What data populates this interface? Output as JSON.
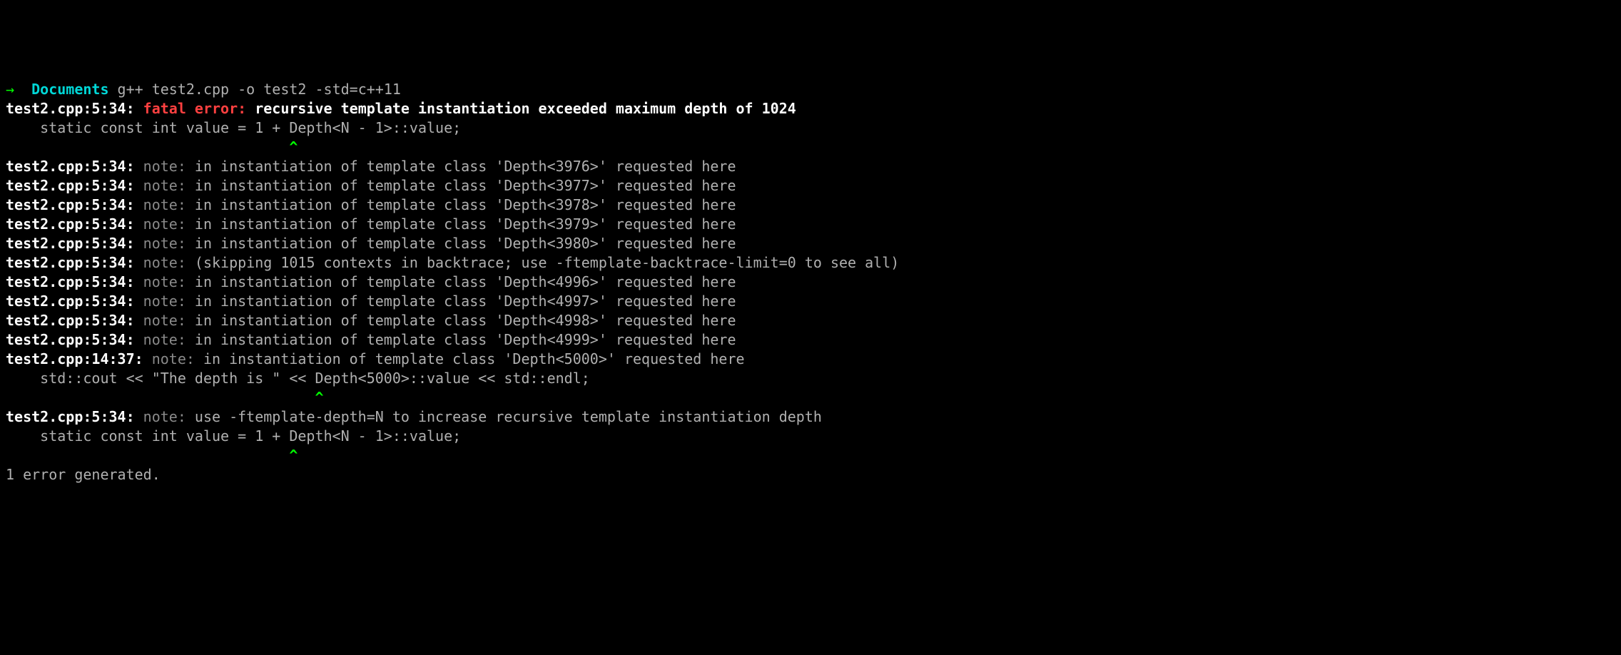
{
  "prompt": {
    "arrow": "→  ",
    "dir": "Documents",
    "cmd": " g++ test2.cpp -o test2 -std=c++11"
  },
  "error": {
    "loc": "test2.cpp:5:34: ",
    "kind": "fatal error: ",
    "msg": "recursive template instantiation exceeded maximum depth of 1024",
    "code": "    static const int value = 1 + Depth<N - 1>::value;",
    "caret": "                                 ^"
  },
  "notes_a": [
    {
      "loc": "test2.cpp:5:34: ",
      "kind": "note: ",
      "msg": "in instantiation of template class 'Depth<3976>' requested here"
    },
    {
      "loc": "test2.cpp:5:34: ",
      "kind": "note: ",
      "msg": "in instantiation of template class 'Depth<3977>' requested here"
    },
    {
      "loc": "test2.cpp:5:34: ",
      "kind": "note: ",
      "msg": "in instantiation of template class 'Depth<3978>' requested here"
    },
    {
      "loc": "test2.cpp:5:34: ",
      "kind": "note: ",
      "msg": "in instantiation of template class 'Depth<3979>' requested here"
    },
    {
      "loc": "test2.cpp:5:34: ",
      "kind": "note: ",
      "msg": "in instantiation of template class 'Depth<3980>' requested here"
    }
  ],
  "skip": {
    "loc": "test2.cpp:5:34: ",
    "kind": "note: ",
    "msg": "(skipping 1015 contexts in backtrace; use -ftemplate-backtrace-limit=0 to see all)"
  },
  "notes_b": [
    {
      "loc": "test2.cpp:5:34: ",
      "kind": "note: ",
      "msg": "in instantiation of template class 'Depth<4996>' requested here"
    },
    {
      "loc": "test2.cpp:5:34: ",
      "kind": "note: ",
      "msg": "in instantiation of template class 'Depth<4997>' requested here"
    },
    {
      "loc": "test2.cpp:5:34: ",
      "kind": "note: ",
      "msg": "in instantiation of template class 'Depth<4998>' requested here"
    },
    {
      "loc": "test2.cpp:5:34: ",
      "kind": "note: ",
      "msg": "in instantiation of template class 'Depth<4999>' requested here"
    }
  ],
  "note_c": {
    "loc": "test2.cpp:14:37: ",
    "kind": "note: ",
    "msg": "in instantiation of template class 'Depth<5000>' requested here",
    "code": "    std::cout << \"The depth is \" << Depth<5000>::value << std::endl;",
    "caret": "                                    ^"
  },
  "note_d": {
    "loc": "test2.cpp:5:34: ",
    "kind": "note: ",
    "msg": "use -ftemplate-depth=N to increase recursive template instantiation depth",
    "code": "    static const int value = 1 + Depth<N - 1>::value;",
    "caret": "                                 ^"
  },
  "summary": "1 error generated."
}
